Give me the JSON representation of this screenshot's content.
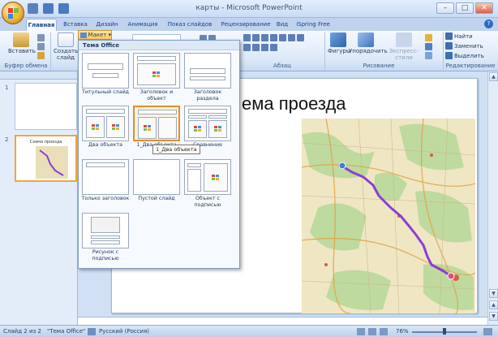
{
  "window": {
    "title": "карты - Microsoft PowerPoint",
    "controls": [
      "–",
      "□",
      "✕"
    ]
  },
  "tabs": [
    "Главная",
    "Вставка",
    "Дизайн",
    "Анимация",
    "Показ слайдов",
    "Рецензирование",
    "Вид",
    "iSpring Free"
  ],
  "active_tab": "Главная",
  "ribbon": {
    "paste": "Вставить",
    "create_slide": "Создать слайд",
    "layout_button": "Макет",
    "clipboard_group": "Буфер обмена",
    "paragraph_group": "Абзац",
    "drawing_group": "Рисование",
    "editing_group": "Редактирование",
    "shapes": "Фигуры",
    "arrange": "Упорядочить",
    "express_styles": "Экспресс-стили",
    "find": "Найти",
    "replace": "Заменить",
    "select": "Выделить"
  },
  "gallery": {
    "header": "Тема Office",
    "layouts": [
      {
        "label": "Титульный слайд"
      },
      {
        "label": "Заголовок и объект"
      },
      {
        "label": "Заголовок раздела"
      },
      {
        "label": "Два объекта"
      },
      {
        "label": "1_Два объекта"
      },
      {
        "label": "Сравнение"
      },
      {
        "label": "Только заголовок"
      },
      {
        "label": "Пустой слайд"
      },
      {
        "label": "Объект с подписью"
      },
      {
        "label": "Рисунок с подписью"
      }
    ],
    "tooltip": "1_Два объекта"
  },
  "slides_pane": {
    "thumbs": [
      {
        "number": "1",
        "title": ""
      },
      {
        "number": "2",
        "title": "Схема проезда"
      }
    ]
  },
  "slide": {
    "title": "ема проезда"
  },
  "status": {
    "slide_counter": "Слайд 2 из 2",
    "theme": "\"Тема Office\"",
    "language": "Русский (Россия)",
    "zoom": "76%"
  },
  "colors": {
    "accent": "#f3a440",
    "ribbon": "#dde9f8",
    "route": "#8a3fd1"
  }
}
